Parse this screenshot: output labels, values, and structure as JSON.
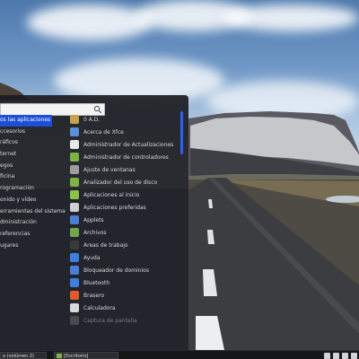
{
  "search": {
    "value": "",
    "placeholder": ""
  },
  "categories": [
    {
      "label": "os las aplicaciones",
      "active": true
    },
    {
      "label": "ccesorios"
    },
    {
      "label": "ráficos"
    },
    {
      "label": "ternet"
    },
    {
      "label": "egos"
    },
    {
      "label": "ficina"
    },
    {
      "label": "rogramación"
    },
    {
      "label": "onido y vídeo"
    },
    {
      "label": "erramientas del sistema"
    },
    {
      "label": "dministración"
    },
    {
      "label": "referencias"
    },
    {
      "label": "ugares"
    }
  ],
  "apps": [
    {
      "label": "0 A.D.",
      "icon": "0ad-icon",
      "color": "#c8a24a"
    },
    {
      "label": "Acerca de Xfce",
      "icon": "xfce-about-icon",
      "color": "#5b8fd6"
    },
    {
      "label": "Administrador de Actualizaciones",
      "icon": "shield-icon",
      "color": "#e8e8e8"
    },
    {
      "label": "Administrador de controladores",
      "icon": "driver-icon",
      "color": "#7cb342"
    },
    {
      "label": "Ajuste de ventanas",
      "icon": "window-tweaks-icon",
      "color": "#9e9e9e"
    },
    {
      "label": "Analizador del uso de disco",
      "icon": "disk-usage-icon",
      "color": "#7cb342"
    },
    {
      "label": "Aplicaciones al inicio",
      "icon": "startup-apps-icon",
      "color": "#8bc34a"
    },
    {
      "label": "Aplicaciones preferidas",
      "icon": "preferred-apps-icon",
      "color": "#cfcfcf"
    },
    {
      "label": "Applets",
      "icon": "applets-icon",
      "color": "#4a7fd8"
    },
    {
      "label": "Archivos",
      "icon": "files-icon",
      "color": "#6fa84a"
    },
    {
      "label": "Áreas de trabajo",
      "icon": "workspaces-icon",
      "color": "#3a3a3a"
    },
    {
      "label": "Ayuda",
      "icon": "help-icon",
      "color": "#3d7fe0"
    },
    {
      "label": "Bloqueador de dominios",
      "icon": "domain-blocker-icon",
      "color": "#4a7fd8"
    },
    {
      "label": "Bluetooth",
      "icon": "bluetooth-icon",
      "color": "#3d7fe0"
    },
    {
      "label": "Brasero",
      "icon": "brasero-icon",
      "color": "#e05a2b"
    },
    {
      "label": "Calculadora",
      "icon": "calculator-icon",
      "color": "#d9d9d9"
    },
    {
      "label": "Captura de pantalla",
      "icon": "screenshot-icon",
      "color": "#777777",
      "faded": true
    }
  ],
  "panel": {
    "tasks": [
      {
        "label": "o (volúmen 2)"
      },
      {
        "label": "[Escritorio]"
      }
    ],
    "tray_icons": [
      "network-icon",
      "volume-icon",
      "battery-icon",
      "clock-icon"
    ]
  }
}
